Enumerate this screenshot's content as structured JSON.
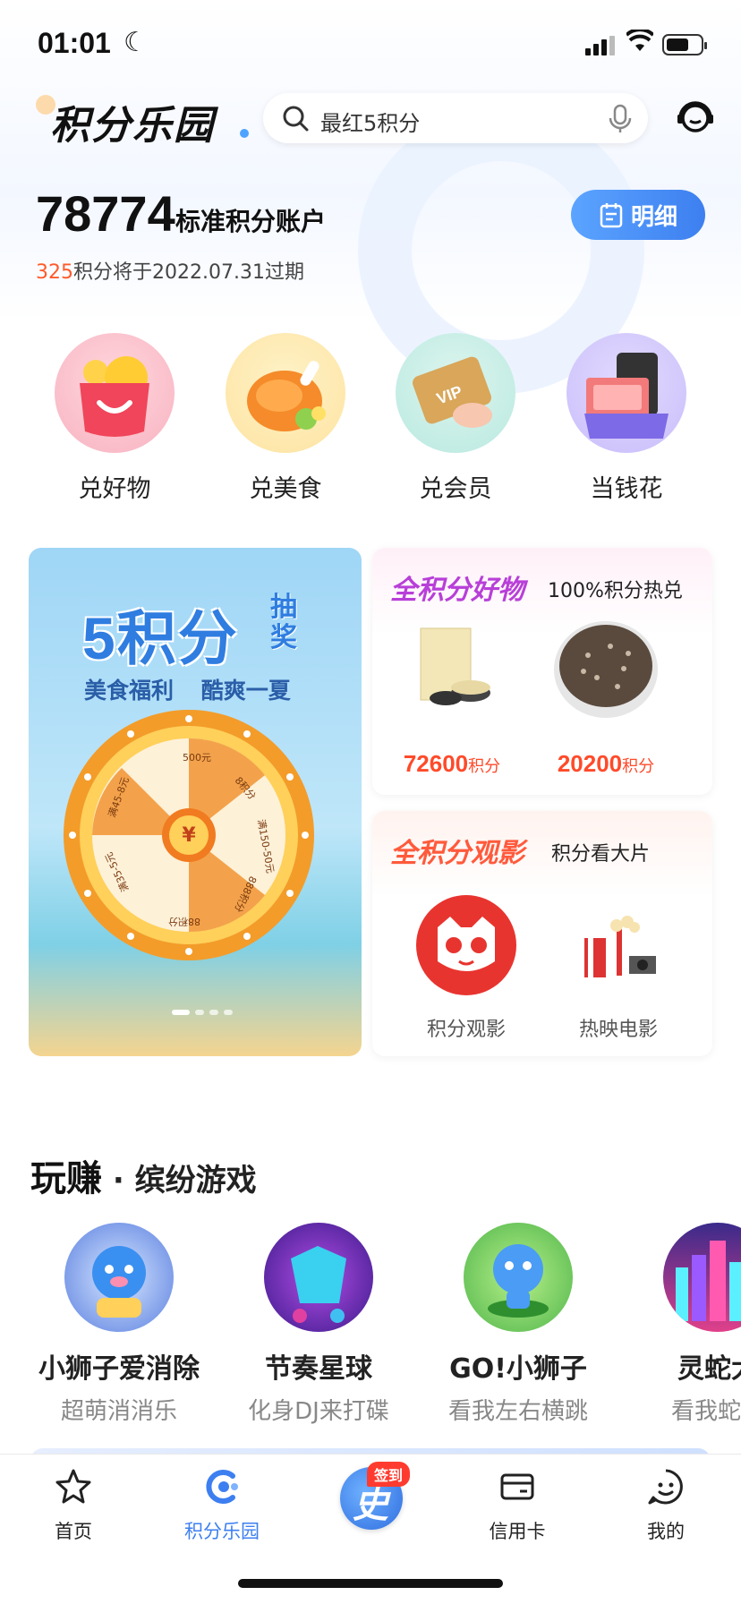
{
  "status": {
    "time": "01:01"
  },
  "header": {
    "logo": "积分乐园",
    "search_placeholder": "最红5积分"
  },
  "points": {
    "value": "78774",
    "label": "标准积分账户",
    "expire_amount": "325",
    "expire_text": "积分将于2022.07.31过期",
    "detail_button": "明细"
  },
  "categories": [
    {
      "label": "兑好物"
    },
    {
      "label": "兑美食"
    },
    {
      "label": "兑会员"
    },
    {
      "label": "当钱花"
    }
  ],
  "lottery": {
    "title": "5积分",
    "draw": "抽奖",
    "subtitle": "美食福利 酷爽一夏",
    "wheel": [
      "500元",
      "8积分",
      "满150-50元",
      "888积分",
      "88积分",
      "满35-5元",
      "满45-8元"
    ],
    "center": "¥",
    "slide_count": 4,
    "slide_active": 1
  },
  "goods": {
    "title": "全积分好物",
    "subtitle": "100%积分热兑",
    "items": [
      {
        "price": "72600",
        "unit": "积分"
      },
      {
        "price": "20200",
        "unit": "积分"
      }
    ]
  },
  "movie": {
    "title": "全积分观影",
    "subtitle": "积分看大片",
    "items": [
      {
        "label": "积分观影"
      },
      {
        "label": "热映电影"
      }
    ]
  },
  "games": {
    "title": "玩赚",
    "subtitle": "缤纷游戏",
    "items": [
      {
        "name": "小狮子爱消除",
        "desc": "超萌消消乐"
      },
      {
        "name": "节奏星球",
        "desc": "化身DJ来打碟"
      },
      {
        "name": "GO!小狮子",
        "desc": "看我左右横跳"
      },
      {
        "name": "灵蛇大",
        "desc": "看我蛇皮"
      }
    ]
  },
  "tabbar": {
    "items": [
      {
        "label": "首页"
      },
      {
        "label": "积分乐园"
      },
      {
        "label": "签到"
      },
      {
        "label": "信用卡"
      },
      {
        "label": "我的"
      }
    ],
    "signin_glyph": "史"
  },
  "colors": {
    "accent": "#3d7ff0",
    "expire": "#ff5a2a",
    "price": "#ff4a2a"
  }
}
